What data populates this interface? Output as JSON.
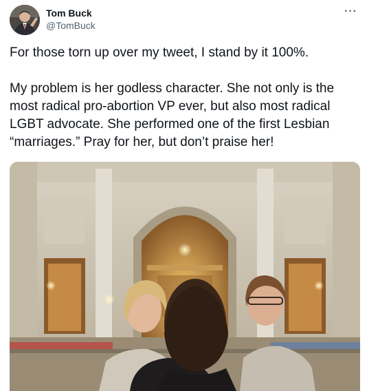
{
  "tweet": {
    "author_name": "Tom Buck",
    "author_handle": "@TomBuck",
    "more_icon": "···",
    "paragraphs": [
      "For those torn up over my tweet, I stand by it 100%.",
      "My problem is her godless character. She not only is the most radical pro-abortion VP ever, but also most radical LGBT advocate. She performed one of the first Lesbian “marriages.” Pray for her, but don’t praise her!"
    ]
  },
  "icons": {
    "avatar": "profile-photo",
    "more": "more-options-icon"
  },
  "colors": {
    "text": "#0f1419",
    "secondary": "#536471",
    "background": "#ffffff"
  }
}
